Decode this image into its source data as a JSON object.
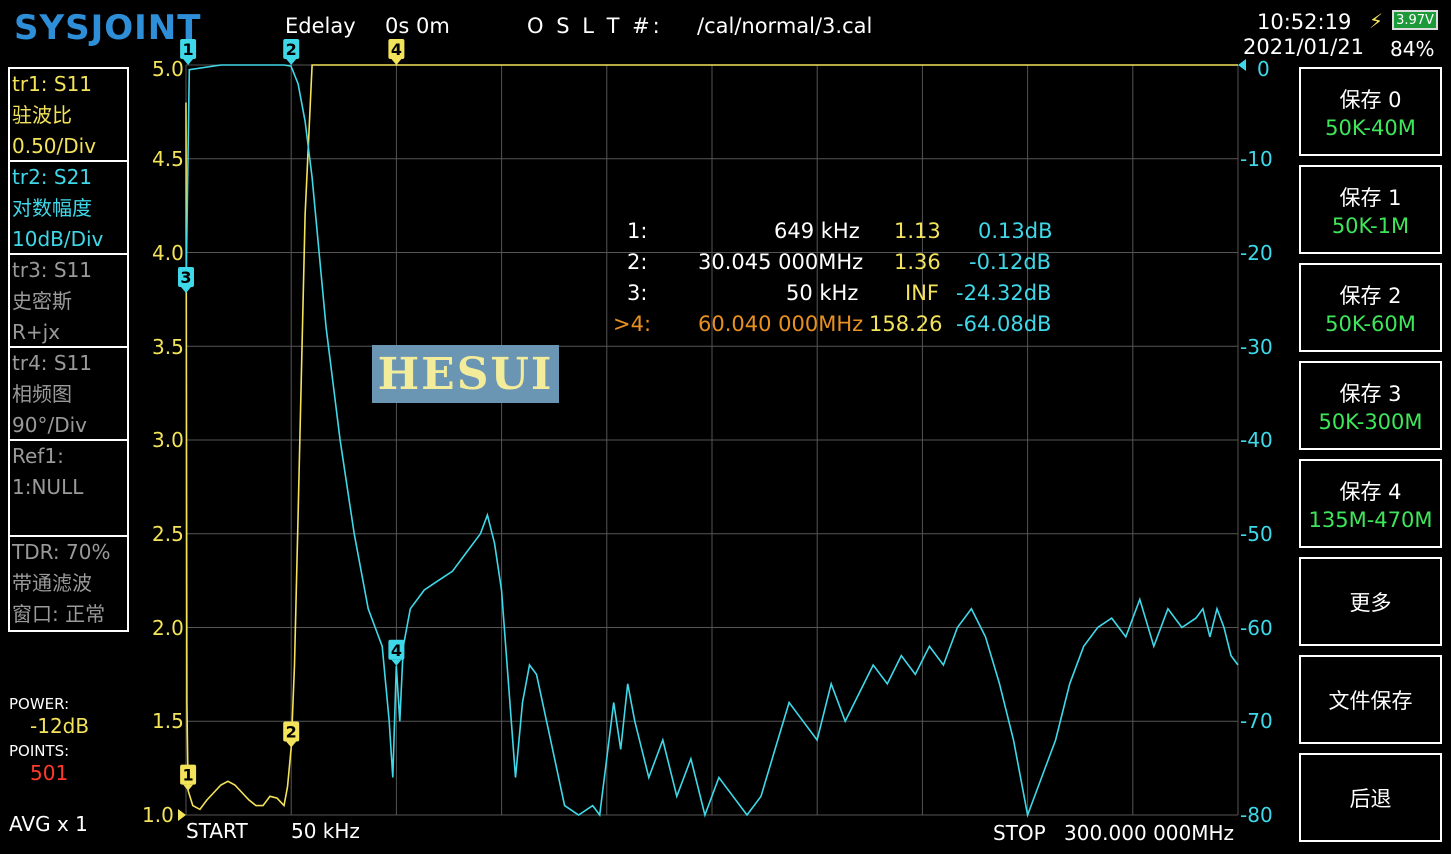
{
  "header": {
    "logo": "SYSJOINT",
    "edelay_label": "Edelay",
    "edelay_value": "0s 0m",
    "oslt_label": "O S L T #:",
    "cal_file": "/cal/normal/3.cal",
    "time": "10:52:19",
    "date": "2021/01/21",
    "battery_voltage": "3.97V",
    "battery_percent": "84%"
  },
  "traces": [
    {
      "l1": "tr1:   S11",
      "l2": "驻波比",
      "l3": "0.50/Div",
      "color": "#f3e35a"
    },
    {
      "l1": "tr2:   S21",
      "l2": "对数幅度",
      "l3": "10dB/Div",
      "color": "#3fd8e8"
    },
    {
      "l1": "tr3:   S11",
      "l2": "史密斯",
      "l3": "R+jx",
      "color": "#9a9a9a"
    },
    {
      "l1": "tr4:   S11",
      "l2": "相频图",
      "l3": "90°/Div",
      "color": "#9a9a9a"
    }
  ],
  "ref": {
    "l1": "Ref1:",
    "l2": "1:NULL"
  },
  "tdr": {
    "l1": "TDR: 70%",
    "l2": "带通滤波",
    "l3": "窗口: 正常"
  },
  "power": {
    "label": "POWER:",
    "value": "-12dB"
  },
  "points": {
    "label": "POINTS:",
    "value": "501"
  },
  "avg": "AVG x 1",
  "footer": {
    "start_label": "START",
    "start_value": "50 kHz",
    "stop_label": "STOP",
    "stop_value": "300.000 000MHz"
  },
  "markers": [
    {
      "id": "1:",
      "freq": "649 kHz",
      "vswr": "1.13",
      "db": "0.13dB"
    },
    {
      "id": "2:",
      "freq": "30.045 000MHz",
      "vswr": "1.36",
      "db": "-0.12dB"
    },
    {
      "id": "3:",
      "freq": "50 kHz",
      "vswr": "INF",
      "db": "-24.32dB"
    },
    {
      "id": ">4:",
      "freq": "60.040 000MHz",
      "vswr": "158.26",
      "db": "-64.08dB"
    }
  ],
  "watermark": "HESUI",
  "buttons": [
    {
      "label": "保存 0",
      "sub": "50K-40M"
    },
    {
      "label": "保存 1",
      "sub": "50K-1M"
    },
    {
      "label": "保存 2",
      "sub": "50K-60M"
    },
    {
      "label": "保存 3",
      "sub": "50K-300M"
    },
    {
      "label": "保存 4",
      "sub": "135M-470M"
    },
    {
      "label": "更多",
      "sub": ""
    },
    {
      "label": "文件保存",
      "sub": ""
    },
    {
      "label": "后退",
      "sub": ""
    }
  ],
  "chart_data": {
    "type": "line",
    "x_start": "50 kHz",
    "x_stop": "300.000 000MHz",
    "left_axis": {
      "ticks": [
        "5.0",
        "4.5",
        "4.0",
        "3.5",
        "3.0",
        "2.5",
        "2.0",
        "1.5",
        "1.0"
      ],
      "ylim": [
        1.0,
        5.0
      ],
      "scale": "0.50/Div"
    },
    "right_axis": {
      "ticks": [
        "0",
        "-10",
        "-20",
        "-30",
        "-40",
        "-50",
        "-60",
        "-70",
        "-80"
      ],
      "ylim": [
        -80,
        0
      ],
      "scale": "10dB/Div"
    },
    "grid": true,
    "series": [
      {
        "name": "tr1: S11",
        "color": "#f3e35a",
        "x_mhz": [
          0.05,
          0.3,
          0.65,
          2,
          4,
          6,
          8,
          10,
          12,
          14,
          16,
          18,
          20,
          22,
          24,
          26,
          28,
          29,
          30.05,
          31,
          32,
          34,
          36,
          38,
          60,
          100,
          150,
          200,
          250,
          300
        ],
        "y": [
          4.8,
          1.6,
          1.13,
          1.05,
          1.03,
          1.08,
          1.12,
          1.16,
          1.18,
          1.16,
          1.12,
          1.08,
          1.05,
          1.05,
          1.1,
          1.09,
          1.05,
          1.15,
          1.36,
          1.8,
          2.6,
          4.2,
          5.0,
          5.0,
          5.0,
          5.0,
          5.0,
          5.0,
          5.0,
          5.0
        ]
      },
      {
        "name": "tr2: S21",
        "color": "#3fd8e8",
        "x_mhz": [
          0.05,
          1,
          10,
          20,
          28,
          30,
          32,
          34,
          36,
          38,
          40,
          44,
          48,
          52,
          56,
          58,
          59,
          60,
          61,
          62,
          64,
          68,
          72,
          76,
          80,
          84,
          86,
          88,
          90,
          92,
          94,
          96,
          98,
          100,
          104,
          108,
          112,
          116,
          118,
          120,
          122,
          124,
          126,
          128,
          132,
          136,
          140,
          144,
          148,
          152,
          156,
          160,
          164,
          168,
          172,
          176,
          180,
          184,
          188,
          192,
          196,
          200,
          204,
          208,
          212,
          216,
          220,
          224,
          228,
          232,
          236,
          240,
          244,
          248,
          252,
          256,
          260,
          264,
          268,
          272,
          276,
          280,
          284,
          288,
          290,
          292,
          294,
          296,
          298,
          300
        ],
        "y": [
          -24.32,
          -0.5,
          0,
          0,
          0,
          -0.12,
          -2,
          -6,
          -12,
          -20,
          -28,
          -40,
          -50,
          -58,
          -62,
          -70,
          -76,
          -64.08,
          -70,
          -62,
          -58,
          -56,
          -55,
          -54,
          -52,
          -50,
          -48,
          -51,
          -56,
          -66,
          -76,
          -68,
          -64,
          -65,
          -72,
          -79,
          -80,
          -79,
          -80,
          -74,
          -68,
          -73,
          -66,
          -70,
          -76,
          -72,
          -78,
          -74,
          -80,
          -76,
          -78,
          -80,
          -78,
          -73,
          -68,
          -70,
          -72,
          -66,
          -70,
          -67,
          -64,
          -66,
          -63,
          -65,
          -62,
          -64,
          -60,
          -58,
          -61,
          -66,
          -72,
          -80,
          -76,
          -72,
          -66,
          -62,
          -60,
          -59,
          -61,
          -57,
          -62,
          -58,
          -60,
          -59,
          -58,
          -61,
          -58,
          -60,
          -63,
          -64
        ]
      }
    ],
    "marker_positions": [
      {
        "id": "1",
        "trace": "tr1",
        "x_mhz": 0.649,
        "y": 1.13
      },
      {
        "id": "2",
        "trace": "tr1",
        "x_mhz": 30.045,
        "y": 1.36
      },
      {
        "id": "3",
        "trace": "tr2",
        "x_mhz": 0.05,
        "y": -24.32
      },
      {
        "id": "4",
        "trace": "tr2",
        "x_mhz": 60.04,
        "y": -64.08
      }
    ]
  }
}
